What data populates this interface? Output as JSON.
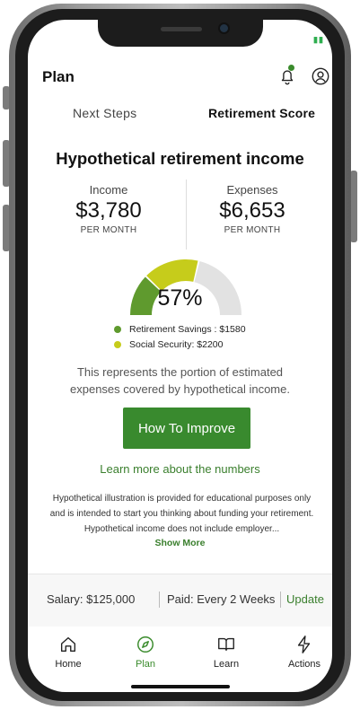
{
  "status": {
    "battery": "▮▮"
  },
  "header": {
    "title": "Plan"
  },
  "tabs": {
    "next_steps": "Next Steps",
    "retirement_score": "Retirement Score"
  },
  "card": {
    "title": "Hypothetical retirement income",
    "income": {
      "label": "Income",
      "amount": "$3,780",
      "unit": "PER MONTH"
    },
    "expenses": {
      "label": "Expenses",
      "amount": "$6,653",
      "unit": "PER MONTH"
    },
    "gauge": {
      "percent_label": "57%",
      "savings_fraction": 0.24,
      "social_security_fraction": 0.33
    },
    "legend": [
      {
        "label": "Retirement Savings : $1580",
        "color": "#5f9a2e"
      },
      {
        "label": "Social Security: $2200",
        "color": "#c6cc1b"
      }
    ],
    "description": "This represents the portion of estimated expenses covered by hypothetical income.",
    "improve_button": "How To Improve",
    "learn_link": "Learn more about the numbers",
    "disclaimer": "Hypothetical illustration is provided for educational purposes only and is intended to start you thinking about funding your retirement. Hypothetical income does not include employer...",
    "show_more": "Show More"
  },
  "salary_bar": {
    "salary": "Salary: $125,000",
    "paid": "Paid: Every 2 Weeks",
    "update": "Update"
  },
  "nav": {
    "home": "Home",
    "plan": "Plan",
    "learn": "Learn",
    "actions": "Actions"
  },
  "colors": {
    "accent": "#398a2e",
    "gauge_track": "#e2e2e2"
  }
}
